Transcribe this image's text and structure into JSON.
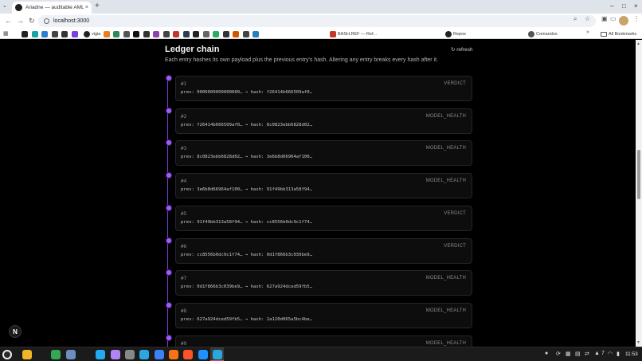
{
  "browser": {
    "tab_title": "Ariadne — auditable AML ...",
    "tab_close": "×",
    "new_tab": "+",
    "url": "localhost:3000",
    "window_controls": [
      "–",
      "□",
      "×"
    ],
    "bookmarks_visible_labels": [
      "vigia",
      "BASH.REF — Ref...",
      "Repos",
      "Comandos"
    ],
    "bookmarks_all": "All Bookmarks"
  },
  "page": {
    "title": "Ledger chain",
    "refresh_label": "↻ refresh",
    "subtitle": "Each entry hashes its own payload plus the previous entry's hash. Altering any entry breaks every hash after it.",
    "accent_color": "#a259ff",
    "entries": [
      {
        "index": "#1",
        "type": "VERDICT",
        "line": "prev: 0000000000000000… → hash: f26414b666509af0…"
      },
      {
        "index": "#2",
        "type": "MODEL_HEALTH",
        "line": "prev: f26414b666509af0… → hash: 8c0823ebb6828d02…"
      },
      {
        "index": "#3",
        "type": "MODEL_HEALTH",
        "line": "prev: 8c0823ebb6828d02… → hash: 3e6b8d66964af100…"
      },
      {
        "index": "#4",
        "type": "MODEL_HEALTH",
        "line": "prev: 3e6b8d66964af100… → hash: 91f49bb313a58f94…"
      },
      {
        "index": "#5",
        "type": "VERDICT",
        "line": "prev: 91f49bb313a58f94… → hash: cc8556b0dc9c1f74…"
      },
      {
        "index": "#6",
        "type": "VERDICT",
        "line": "prev: cc8556b0dc9c1f74… → hash: 0d1f866b3c039be9…"
      },
      {
        "index": "#7",
        "type": "MODEL_HEALTH",
        "line": "prev: 0d1f866b3c039be9… → hash: 627a924dced59fb5…"
      },
      {
        "index": "#8",
        "type": "MODEL_HEALTH",
        "line": "prev: 627a924dced59fb5… → hash: 2a120d065a5bc4be…"
      },
      {
        "index": "#9",
        "type": "MODEL_HEALTH",
        "line": ""
      }
    ]
  },
  "nextjs_badge": "N",
  "taskbar": {
    "tray_number": "7",
    "clock": "11:53"
  }
}
